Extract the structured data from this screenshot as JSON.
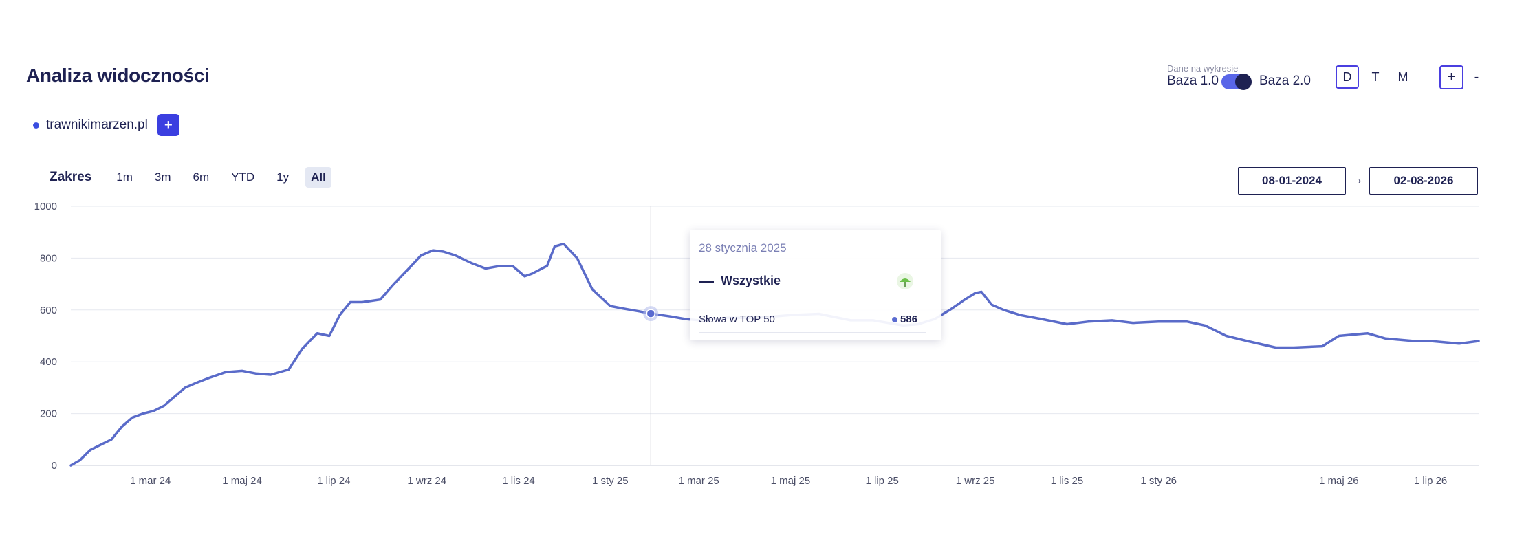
{
  "header": {
    "title": "Analiza widoczności"
  },
  "domain": {
    "name": "trawnikimarzen.pl",
    "add_label": "+"
  },
  "data_toggle": {
    "label": "Dane na wykresie",
    "left": "Baza 1.0",
    "right": "Baza 2.0"
  },
  "period": {
    "d": "D",
    "t": "T",
    "m": "M"
  },
  "zoom": {
    "plus": "+",
    "minus": "-"
  },
  "range": {
    "label": "Zakres",
    "options": [
      "1m",
      "3m",
      "6m",
      "YTD",
      "1y",
      "All"
    ],
    "active": "All",
    "from": "08-01-2024",
    "arrow": "→",
    "to": "02-08-2026"
  },
  "tooltip": {
    "date": "28 stycznia 2025",
    "series": "Wszystkie",
    "metric": "Słowa w TOP 50",
    "value": "586"
  },
  "colors": {
    "line": "#5a6bc9",
    "accent": "#3b3fe0",
    "text": "#1e2152"
  },
  "chart_data": {
    "type": "line",
    "series": [
      {
        "name": "Wszystkie",
        "x": [
          "2024-01-08",
          "2024-01-14",
          "2024-01-21",
          "2024-01-28",
          "2024-02-04",
          "2024-02-11",
          "2024-02-18",
          "2024-02-25",
          "2024-03-03",
          "2024-03-10",
          "2024-03-17",
          "2024-03-24",
          "2024-04-01",
          "2024-04-10",
          "2024-04-20",
          "2024-05-01",
          "2024-05-10",
          "2024-05-20",
          "2024-06-01",
          "2024-06-10",
          "2024-06-20",
          "2024-06-28",
          "2024-07-05",
          "2024-07-12",
          "2024-07-20",
          "2024-08-01",
          "2024-08-10",
          "2024-08-20",
          "2024-08-28",
          "2024-09-05",
          "2024-09-12",
          "2024-09-20",
          "2024-10-01",
          "2024-10-10",
          "2024-10-20",
          "2024-10-28",
          "2024-11-05",
          "2024-11-10",
          "2024-11-20",
          "2024-11-25",
          "2024-12-01",
          "2024-12-10",
          "2024-12-20",
          "2025-01-01",
          "2025-01-10",
          "2025-01-20",
          "2025-01-28",
          "2025-02-10",
          "2025-02-20",
          "2025-03-01",
          "2025-03-20",
          "2025-04-10",
          "2025-05-01",
          "2025-05-20",
          "2025-06-10",
          "2025-06-25",
          "2025-07-05",
          "2025-07-15",
          "2025-07-25",
          "2025-08-05",
          "2025-08-15",
          "2025-08-25",
          "2025-09-01",
          "2025-09-05",
          "2025-09-12",
          "2025-09-20",
          "2025-10-01",
          "2025-10-15",
          "2025-11-01",
          "2025-11-15",
          "2025-12-01",
          "2025-12-15",
          "2026-01-01",
          "2026-01-20",
          "2026-02-01",
          "2026-02-15",
          "2026-03-01",
          "2026-03-20",
          "2026-04-01",
          "2026-04-20",
          "2026-05-01",
          "2026-05-20",
          "2026-06-01",
          "2026-06-20",
          "2026-07-01",
          "2026-07-20",
          "2026-08-02"
        ],
        "y": [
          0,
          20,
          60,
          80,
          100,
          150,
          185,
          200,
          210,
          230,
          265,
          300,
          320,
          340,
          360,
          365,
          355,
          350,
          370,
          450,
          510,
          500,
          580,
          630,
          630,
          640,
          700,
          760,
          810,
          830,
          825,
          810,
          780,
          760,
          770,
          770,
          730,
          740,
          770,
          845,
          855,
          800,
          680,
          615,
          605,
          595,
          586,
          575,
          565,
          560,
          570,
          570,
          580,
          585,
          560,
          560,
          550,
          540,
          545,
          565,
          600,
          640,
          665,
          670,
          620,
          600,
          580,
          565,
          545,
          555,
          560,
          550,
          555,
          555,
          540,
          500,
          480,
          455,
          455,
          460,
          500,
          510,
          490,
          480,
          480,
          470,
          480
        ]
      }
    ],
    "x_tick_labels": [
      "1 mar 24",
      "1 maj 24",
      "1 lip 24",
      "1 wrz 24",
      "1 lis 24",
      "1 sty 25",
      "1 mar 25",
      "1 maj 25",
      "1 lip 25",
      "1 wrz 25",
      "1 lis 25",
      "1 sty 26",
      "1 maj 26",
      "1 lip 26"
    ],
    "x_ticks": [
      "2024-03-01",
      "2024-05-01",
      "2024-07-01",
      "2024-09-01",
      "2024-11-01",
      "2025-01-01",
      "2025-03-01",
      "2025-05-01",
      "2025-07-01",
      "2025-09-01",
      "2025-11-01",
      "2026-01-01",
      "2026-05-01",
      "2026-07-01"
    ],
    "y_ticks": [
      0,
      200,
      400,
      600,
      800,
      1000
    ],
    "ylim": [
      0,
      1000
    ],
    "xlim": [
      "2024-01-08",
      "2026-08-02"
    ],
    "grid": true,
    "highlight": {
      "x": "2025-01-28",
      "y": 586
    }
  }
}
